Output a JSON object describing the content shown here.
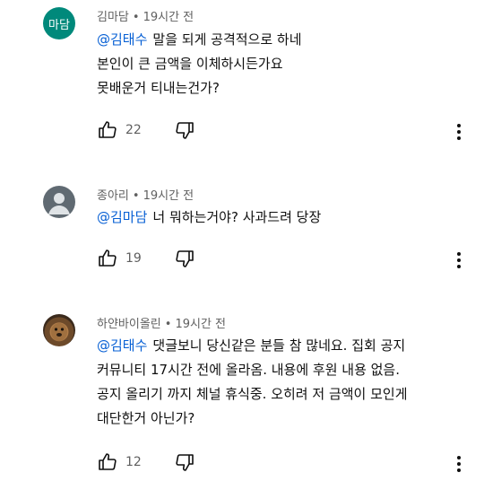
{
  "comments": [
    {
      "author": "김마담",
      "avatar_text": "마담",
      "time": "19시간 전",
      "mention": "@김태수",
      "lines": [
        "말을 되게 공격적으로 하네",
        "본인이 큰 금액을 이체하시든가요",
        "못배운거 티내는건가?"
      ],
      "likes": "22"
    },
    {
      "author": "종아리",
      "time": "19시간 전",
      "mention": "@김마담",
      "lines": [
        "너 뭐하는거야? 사과드려 당장"
      ],
      "likes": "19"
    },
    {
      "author": "하얀바이올린",
      "time": "19시간 전",
      "mention": "@김태수",
      "lines": [
        "댓글보니 당신같은 분들 참 많네요. 집회 공지",
        "커뮤니티 17시간 전에 올라옴. 내용에 후원 내용 없음.",
        "공지 올리기 까지 체널 휴식중. 오히려 저 금액이 모인게",
        "대단한거 아닌가?"
      ],
      "likes": "12"
    }
  ],
  "colors": {
    "mention": "#065fd4",
    "meta": "#606060",
    "avatar_green": "#00897b"
  },
  "icons": {
    "like": "thumb-up-icon",
    "dislike": "thumb-down-icon",
    "more": "more-vertical-icon"
  }
}
